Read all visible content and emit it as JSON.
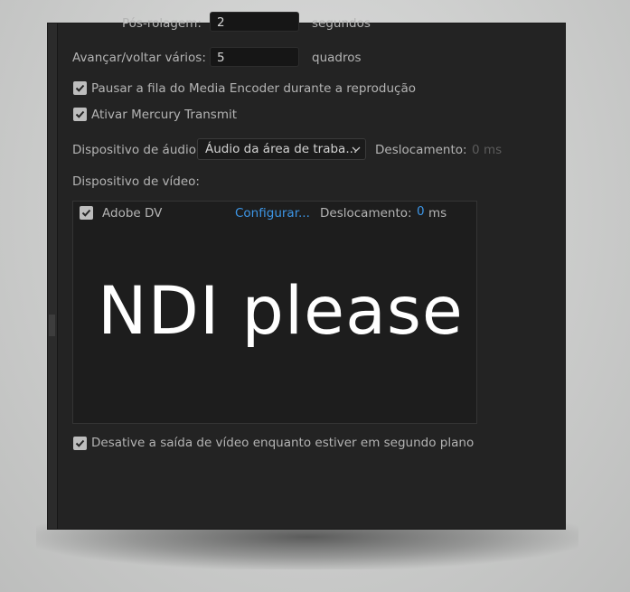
{
  "playback": {
    "postroll_label": "Pós-rolagem:",
    "postroll_value": "2",
    "postroll_unit": "segundos",
    "step_label": "Avançar/voltar vários:",
    "step_value": "5",
    "step_unit": "quadros"
  },
  "options": {
    "pause_media_encoder": "Pausar a fila do Media Encoder durante a reprodução",
    "enable_mercury": "Ativar Mercury Transmit"
  },
  "audio": {
    "device_label": "Dispositivo de áudio:",
    "device_value": "Áudio da área de traba...",
    "offset_label": "Deslocamento:",
    "offset_value": "0",
    "offset_unit": "ms"
  },
  "video": {
    "device_label": "Dispositivo de vídeo:",
    "devices": [
      {
        "name": "Adobe DV",
        "configure": "Configurar...",
        "offset_label": "Deslocamento:",
        "offset_value": "0",
        "offset_unit": "ms"
      }
    ],
    "overlay_text": "NDI please",
    "disable_background": "Desative a saída de vídeo enquanto estiver em segundo plano"
  },
  "icons": {
    "checkbox": "check-icon",
    "dropdown": "chevron-down-icon"
  },
  "colors": {
    "panel_bg": "#232323",
    "link": "#3d96e6",
    "text": "#b4b4b4"
  }
}
